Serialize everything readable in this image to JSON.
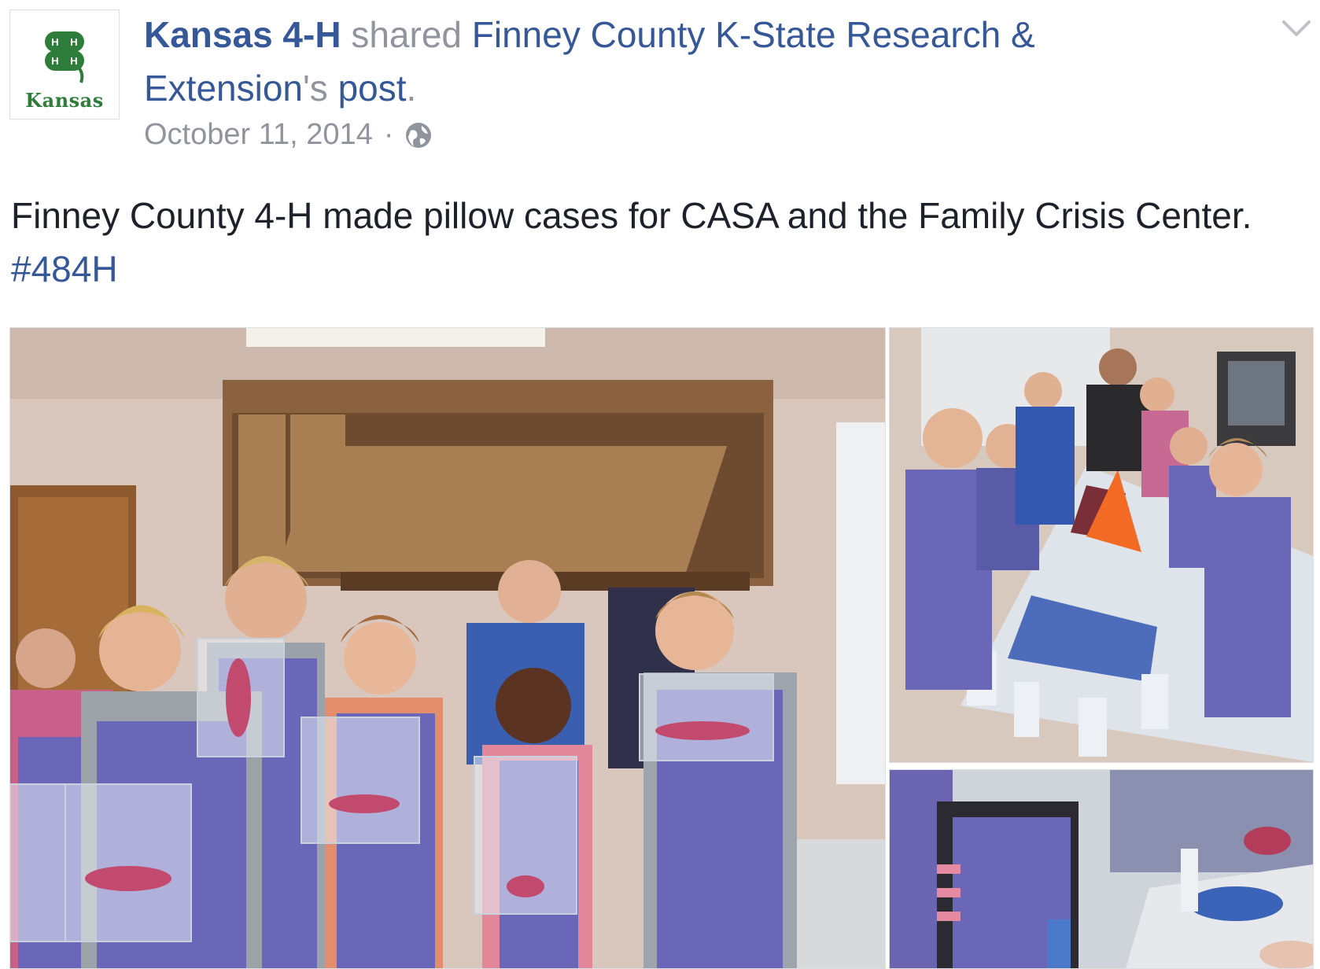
{
  "post": {
    "actor": "Kansas 4-H",
    "verb": "shared",
    "shared_page": "Finney County K-State Research & Extension",
    "possessive": "'s",
    "object": "post",
    "period": ".",
    "date": "October 11, 2014",
    "separator": "·",
    "privacy_icon": "globe-icon",
    "menu_icon": "chevron-down-icon",
    "text": "Finney County 4-H made pillow cases for CASA and the Family Crisis Center.",
    "hashtag": "#484H"
  },
  "avatar": {
    "logo_icon": "four-leaf-clover-icon",
    "logo_letter": "H",
    "word": "Kansas",
    "colors": {
      "clover": "#2f7d3b",
      "text": "#2f7d3b",
      "border": "#dddfe2"
    }
  },
  "photos": [
    {
      "name": "group-photo",
      "subject": "children holding bags with tie-dyed pillow cases"
    },
    {
      "name": "dye-table-photo",
      "subject": "children dyeing fabric at a table"
    },
    {
      "name": "dye-closeup-photo",
      "subject": "close-up of hands applying dye"
    }
  ],
  "colors": {
    "link": "#365899",
    "meta": "#90949c",
    "text": "#1d2129",
    "apron": "#6a66b8"
  }
}
